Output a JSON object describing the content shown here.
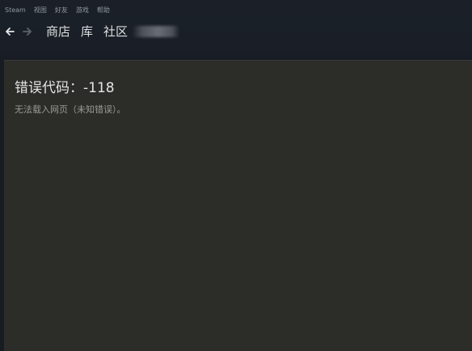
{
  "menubar": {
    "items": [
      {
        "label": "Steam"
      },
      {
        "label": "视图"
      },
      {
        "label": "好友"
      },
      {
        "label": "游戏"
      },
      {
        "label": "帮助"
      }
    ]
  },
  "navbar": {
    "back_icon": "arrow-left-icon",
    "forward_icon": "arrow-right-icon",
    "links": [
      {
        "label": "商店"
      },
      {
        "label": "库"
      },
      {
        "label": "社区"
      }
    ]
  },
  "error": {
    "title": "错误代码：-118",
    "description": "无法载入网页（未知错误）。"
  },
  "colors": {
    "window_bg": "#171a21",
    "content_bg": "#2c2c29",
    "nav_text": "#dcdedf",
    "menu_text": "#8f98a0",
    "desc_text": "#9a9a96"
  }
}
